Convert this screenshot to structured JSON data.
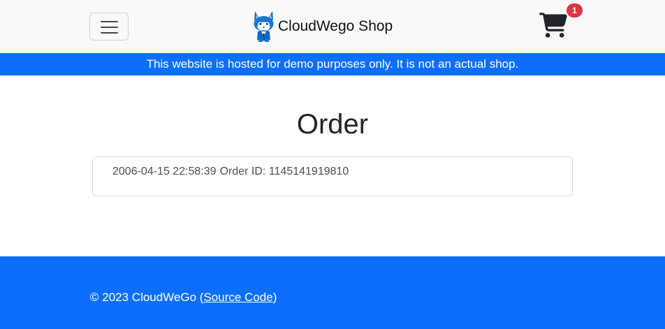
{
  "navbar": {
    "menu_toggle_icon": "hamburger-menu-icon",
    "brand_logo_icon": "cloudwego-mascot-logo",
    "brand_name": "CloudWego Shop",
    "cart_icon": "shopping-cart-icon",
    "cart_count": "1"
  },
  "notice": {
    "text": "This website is hosted for demo purposes only. It is not an actual shop."
  },
  "main": {
    "title": "Order",
    "orders": [
      {
        "datetime": "2006-04-15 22:58:39",
        "order_id_text": "Order ID: 1145141919810"
      }
    ]
  },
  "footer": {
    "copyright": "© 2023 CloudWeGo (",
    "source_link": "Source Code",
    "closing": ")"
  },
  "colors": {
    "primary": "#0d6efd",
    "navbar_bg": "#f8f9fa",
    "badge": "#dc3545"
  }
}
